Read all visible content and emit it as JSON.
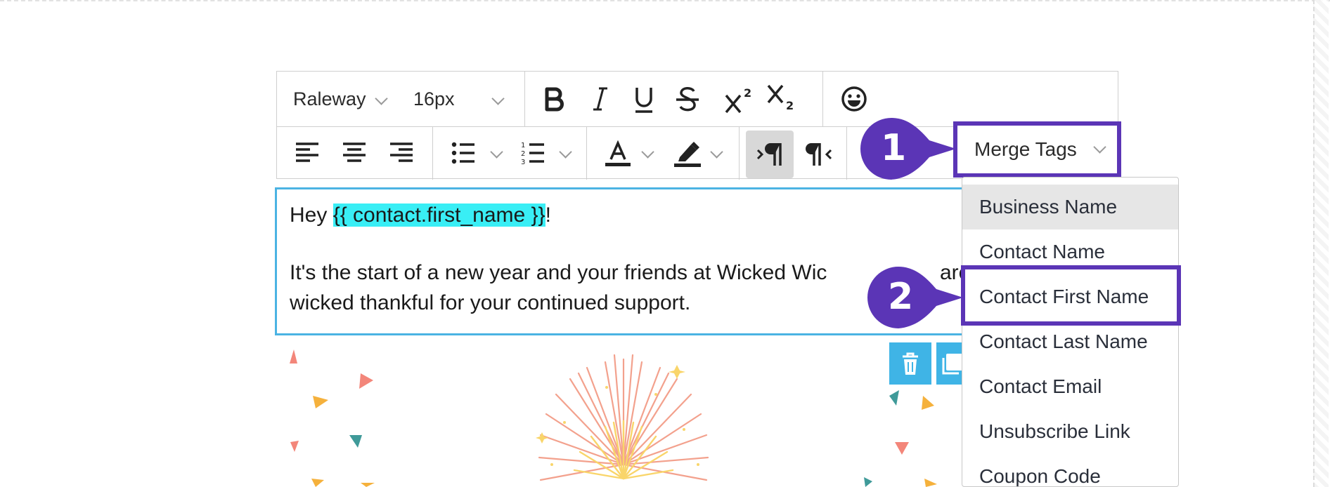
{
  "toolbar": {
    "font_family_value": "Raleway",
    "font_size_value": "16px",
    "bold_icon": "bold-icon",
    "italic_icon": "italic-icon",
    "underline_icon": "underline-icon",
    "strikethrough_icon": "strikethrough-icon",
    "superscript_icon": "superscript-icon",
    "subscript_icon": "subscript-icon",
    "emoji_icon": "emoji-icon",
    "align_icons": [
      "align-left-icon",
      "align-center-icon",
      "align-right-icon"
    ],
    "list_icons": [
      "bulleted-list-icon",
      "numbered-list-icon"
    ],
    "color_icons": [
      "text-color-icon",
      "highlight-color-icon"
    ],
    "direction_icons": [
      "ltr-direction-icon",
      "rtl-direction-icon"
    ],
    "merge_tags_label": "Merge Tags"
  },
  "editor": {
    "greeting_prefix": "Hey ",
    "merge_tag": "{{ contact.first_name }}",
    "greeting_suffix": "!",
    "body_line_1": "It's the start of a new year and your friends at Wicked Wic",
    "body_line_1_end": "are",
    "body_line_2": "wicked thankful for your continued support."
  },
  "dropdown": {
    "items": [
      "Business Name",
      "Contact Name",
      "Contact First Name",
      "Contact Last Name",
      "Contact Email",
      "Unsubscribe Link",
      "Coupon Code"
    ],
    "hovered_index": 0,
    "selected_index": 2
  },
  "callouts": {
    "step_1": "1",
    "step_2": "2",
    "color": "#5b35b6"
  },
  "actions": {
    "delete_icon": "trash-icon",
    "duplicate_icon": "duplicate-icon",
    "color": "#3fb4e6"
  },
  "colors": {
    "editor_border": "#4bb3e3",
    "merge_tag_highlight": "#39eef5",
    "callout": "#5b35b6"
  }
}
